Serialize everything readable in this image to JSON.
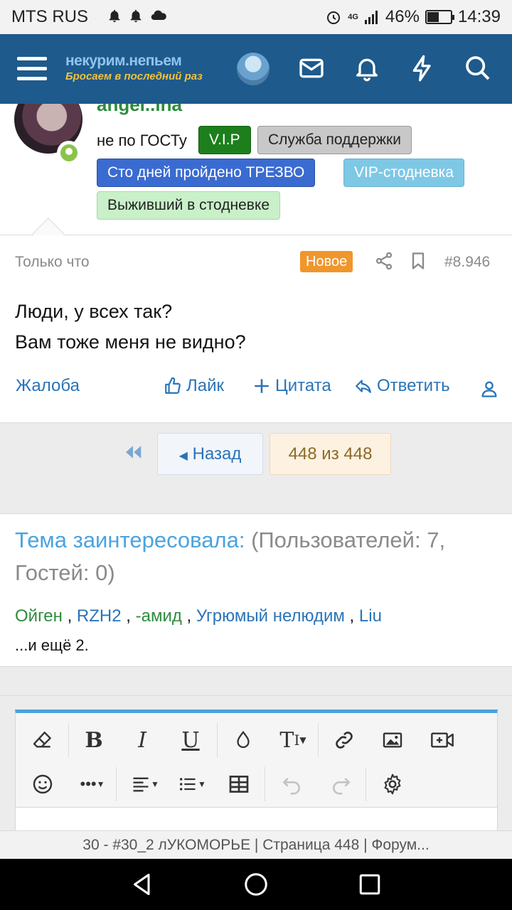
{
  "status_bar": {
    "carrier": "MTS RUS",
    "network": "4G",
    "battery": "46%",
    "battery_level": 0.46,
    "time": "14:39"
  },
  "header": {
    "logo_main": "некурим.непьем",
    "logo_sub": "Бросаем в последний раз"
  },
  "post": {
    "username": "angel..ina",
    "user_title": "не по ГОСТу",
    "badges": {
      "vip": "V.I.P",
      "support": "Служба поддержки",
      "hundred_days": "Сто дней пройдено ТРЕЗВО",
      "vip_stodnevka": "VIP-стодневка",
      "survivor": "Выживший в стодневке"
    },
    "time": "Только что",
    "new_label": "Новое",
    "number": "#8.946",
    "body_line1": "Люди, у всех так?",
    "body_line2": "Вам тоже меня не видно?",
    "actions": {
      "report": "Жалоба",
      "like": "Лайк",
      "quote": "Цитата",
      "reply": "Ответить"
    }
  },
  "pagination": {
    "prev": "Назад",
    "current": "448 из 448"
  },
  "interested": {
    "label": "Тема заинтересовала:",
    "counts": " (Пользователей: 7, Гостей: 0)",
    "users": [
      "Ойген",
      "RZH2",
      "-амид",
      "Угрюмый нелюдим",
      "Liu"
    ],
    "more": "...и ещё 2."
  },
  "page_title": "30 - #30_2 лУКОМОРЬЕ | Страница 448 | Форум..."
}
